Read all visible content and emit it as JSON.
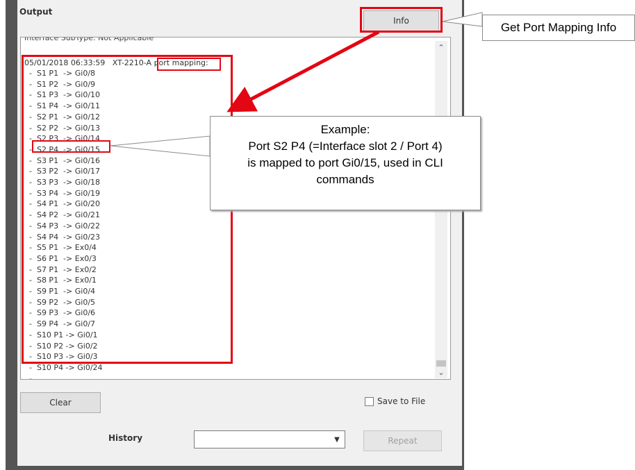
{
  "output": {
    "title": "Output",
    "info_label": "Info",
    "top_text": "Interface SubType: Not Applicable",
    "header_text": "05/01/2018 06:33:59   XT-2210-A ",
    "header_highlight": "port mapping:",
    "lines": [
      "  -  S1 P1  -> Gi0/8",
      "  -  S1 P2  -> Gi0/9",
      "  -  S1 P3  -> Gi0/10",
      "  -  S1 P4  -> Gi0/11",
      "  -  S2 P1  -> Gi0/12",
      "  -  S2 P2  -> Gi0/13",
      "  -  S2 P3  -> Gi0/14",
      "  -  S2 P4  -> Gi0/15",
      "  -  S3 P1  -> Gi0/16",
      "  -  S3 P2  -> Gi0/17",
      "  -  S3 P3  -> Gi0/18",
      "  -  S3 P4  -> Gi0/19",
      "  -  S4 P1  -> Gi0/20",
      "  -  S4 P2  -> Gi0/21",
      "  -  S4 P3  -> Gi0/22",
      "  -  S4 P4  -> Gi0/23",
      "  -  S5 P1  -> Ex0/4",
      "  -  S6 P1  -> Ex0/3",
      "  -  S7 P1  -> Ex0/2",
      "  -  S8 P1  -> Ex0/1",
      "  -  S9 P1  -> Gi0/4",
      "  -  S9 P2  -> Gi0/5",
      "  -  S9 P3  -> Gi0/6",
      "  -  S9 P4  -> Gi0/7",
      "  -  S10 P1 -> Gi0/1",
      "  -  S10 P2 -> Gi0/2",
      "  -  S10 P3 -> Gi0/3",
      "  -  S10 P4 -> Gi0/24",
      "  -  ..."
    ]
  },
  "controls": {
    "clear_label": "Clear",
    "save_label": "Save to File",
    "history_label": "History",
    "history_value": "",
    "repeat_label": "Repeat"
  },
  "callouts": {
    "top": "Get Port Mapping Info",
    "example_lines": [
      "Example:",
      "Port S2 P4 (=Interface slot 2 / Port 4)",
      "is mapped to port Gi0/15, used in CLI",
      "commands"
    ]
  },
  "colors": {
    "highlight": "#e30613"
  }
}
